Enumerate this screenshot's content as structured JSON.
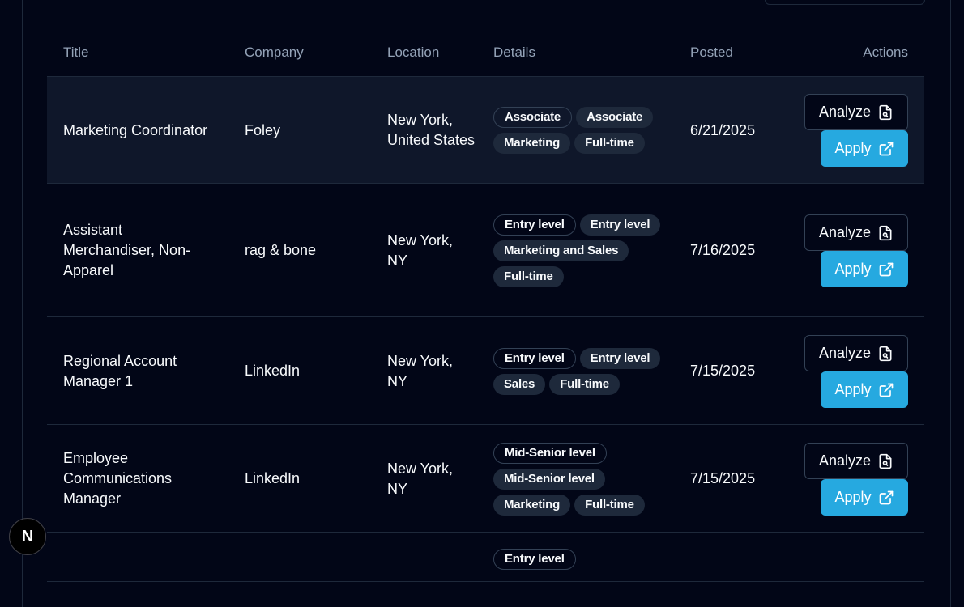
{
  "header": {
    "title": "Title",
    "company": "Company",
    "location": "Location",
    "details": "Details",
    "posted": "Posted",
    "actions": "Actions"
  },
  "actions": {
    "analyze_label": "Analyze",
    "apply_label": "Apply"
  },
  "rows": [
    {
      "title": "Marketing Coordinator",
      "company": "Foley",
      "location": "New York, United States",
      "badges": [
        {
          "label": "Associate",
          "style": "outline"
        },
        {
          "label": "Associate",
          "style": "filled"
        },
        {
          "label": "Marketing",
          "style": "filled"
        },
        {
          "label": "Full-time",
          "style": "filled"
        }
      ],
      "posted": "6/21/2025",
      "highlighted": true
    },
    {
      "title": "Assistant Merchandiser, Non-Apparel",
      "company": "rag & bone",
      "location": "New York, NY",
      "badges": [
        {
          "label": "Entry level",
          "style": "outline"
        },
        {
          "label": "Entry level",
          "style": "filled"
        },
        {
          "label": "Marketing and Sales",
          "style": "filled"
        },
        {
          "label": "Full-time",
          "style": "filled"
        }
      ],
      "posted": "7/16/2025",
      "highlighted": false
    },
    {
      "title": "Regional Account Manager 1",
      "company": "LinkedIn",
      "location": "New York, NY",
      "badges": [
        {
          "label": "Entry level",
          "style": "outline"
        },
        {
          "label": "Entry level",
          "style": "filled"
        },
        {
          "label": "Sales",
          "style": "filled"
        },
        {
          "label": "Full-time",
          "style": "filled"
        }
      ],
      "posted": "7/15/2025",
      "highlighted": false
    },
    {
      "title": "Employee Communications Manager",
      "company": "LinkedIn",
      "location": "New York, NY",
      "badges": [
        {
          "label": "Mid-Senior level",
          "style": "outline"
        },
        {
          "label": "Mid-Senior level",
          "style": "filled"
        },
        {
          "label": "Marketing",
          "style": "filled"
        },
        {
          "label": "Full-time",
          "style": "filled"
        }
      ],
      "posted": "7/15/2025",
      "highlighted": false
    },
    {
      "title": "",
      "company": "",
      "location": "",
      "badges": [
        {
          "label": "Entry level",
          "style": "outline"
        }
      ],
      "posted": "",
      "highlighted": false
    }
  ],
  "dev_indicator": {
    "label": "N"
  },
  "colors": {
    "background": "#020617",
    "row_highlight": "#0f172a",
    "border": "#1e293b",
    "header_text": "#94a3b8",
    "apply_button": "#26a9e0",
    "badge_filled": "#1e293b"
  },
  "icons": {
    "analyze": "file-scan-icon",
    "apply": "external-link-icon"
  }
}
